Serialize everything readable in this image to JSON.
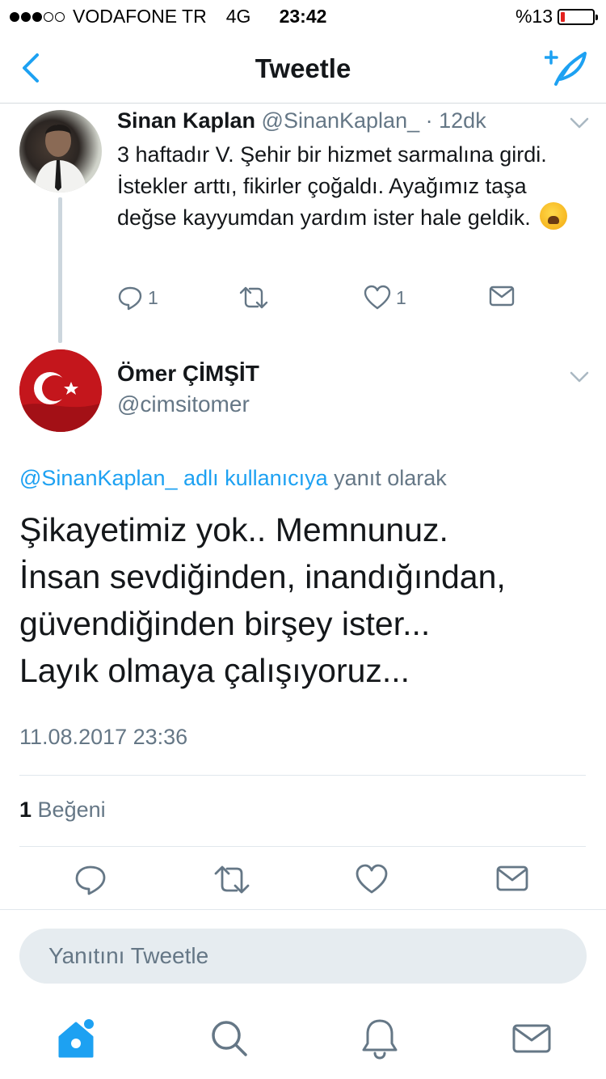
{
  "status_bar": {
    "carrier": "VODAFONE TR",
    "network": "4G",
    "time": "23:42",
    "battery_text": "%13",
    "battery_level": 0.13,
    "signal_bars_on": 3,
    "signal_bars_total": 5
  },
  "nav": {
    "title": "Tweetle",
    "back_icon": "chevron-left-icon",
    "compose_icon": "compose-tweet-icon"
  },
  "parent_tweet": {
    "name": "Sinan Kaplan",
    "handle": "@SinanKaplan_",
    "separator": "·",
    "time_ago": "12dk",
    "text": "3 haftadır V. Şehir bir hizmet sarmalına girdi. İstekler arttı, fikirler çoğaldı. Ayağımız taşa değse kayyumdan yardım ister hale geldik.",
    "emoji": "weary-face-emoji",
    "reply_count": "1",
    "like_count": "1"
  },
  "main_tweet": {
    "name": "Ömer ÇİMŞİT",
    "handle": "@cimsitomer",
    "reply_link": "@SinanKaplan_ adlı kullanıcıya",
    "reply_suffix": "yanıt olarak",
    "lines": [
      "Şikayetimiz yok.. Memnunuz.",
      "İnsan sevdiğinden, inandığından,",
      "güvendiğinden birşey ister...",
      "Layık olmaya çalışıyoruz..."
    ],
    "datetime": "11.08.2017 23:36",
    "likes_count": "1",
    "likes_label": "Beğeni"
  },
  "reply_box": {
    "placeholder": "Yanıtını Tweetle"
  },
  "tab_bar": {
    "items": [
      "home-icon",
      "search-icon",
      "notifications-icon",
      "messages-icon"
    ]
  },
  "colors": {
    "accent": "#1da1f2",
    "secondary_text": "#657786",
    "primary_text": "#14171a",
    "divider": "#e1e8ed",
    "reply_box_bg": "#e6ecf0",
    "battery_low": "#e3221f"
  }
}
